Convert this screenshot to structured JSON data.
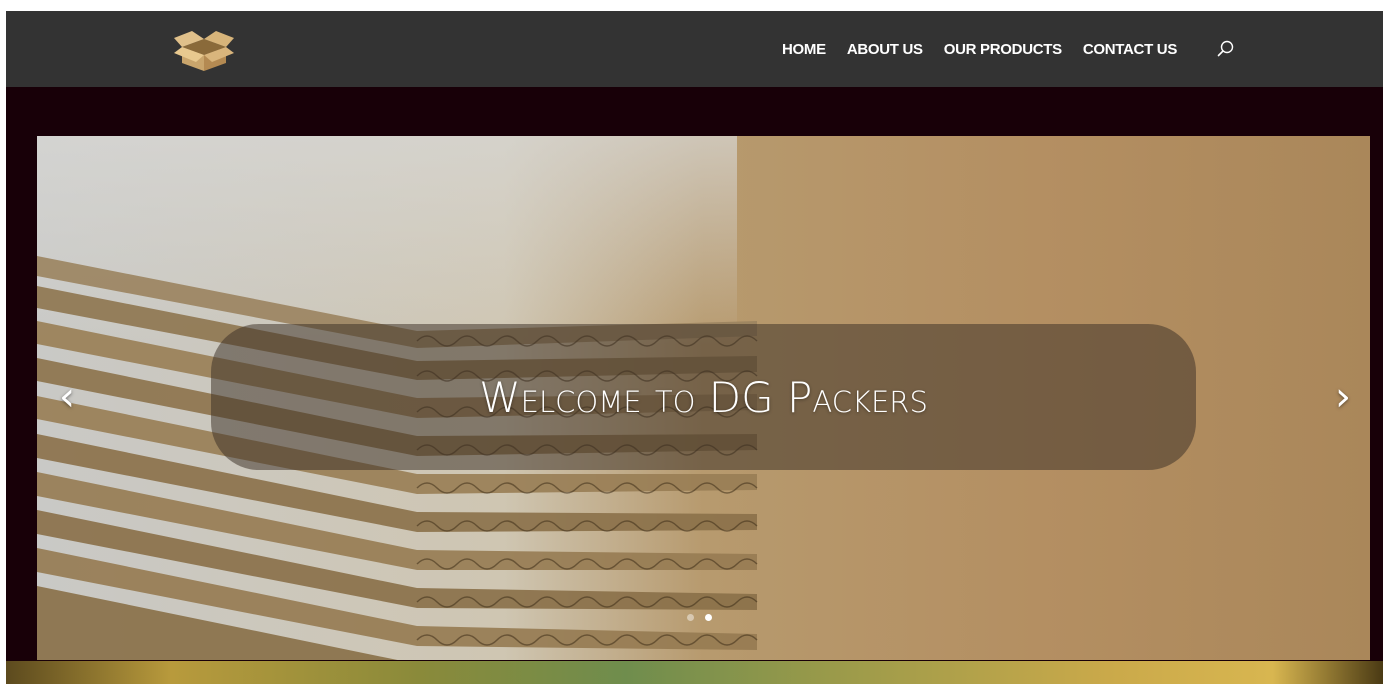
{
  "header": {
    "logo_icon": "open-cardboard-box-icon",
    "nav": [
      {
        "label": "HOME"
      },
      {
        "label": "ABOUT US"
      },
      {
        "label": "OUR PRODUCTS"
      },
      {
        "label": "CONTACT US"
      }
    ],
    "search_icon": "search-icon"
  },
  "hero": {
    "caption": "Welcome to DG Packers",
    "prev_icon": "chevron-left-icon",
    "next_icon": "chevron-right-icon",
    "prev_glyph": "‹",
    "next_glyph": "›",
    "slide_count": 2,
    "active_slide": 2
  },
  "colors": {
    "header_bg": "#333333",
    "page_bg": "#180008",
    "nav_text": "#ffffff",
    "caption_text": "#ffffff"
  }
}
